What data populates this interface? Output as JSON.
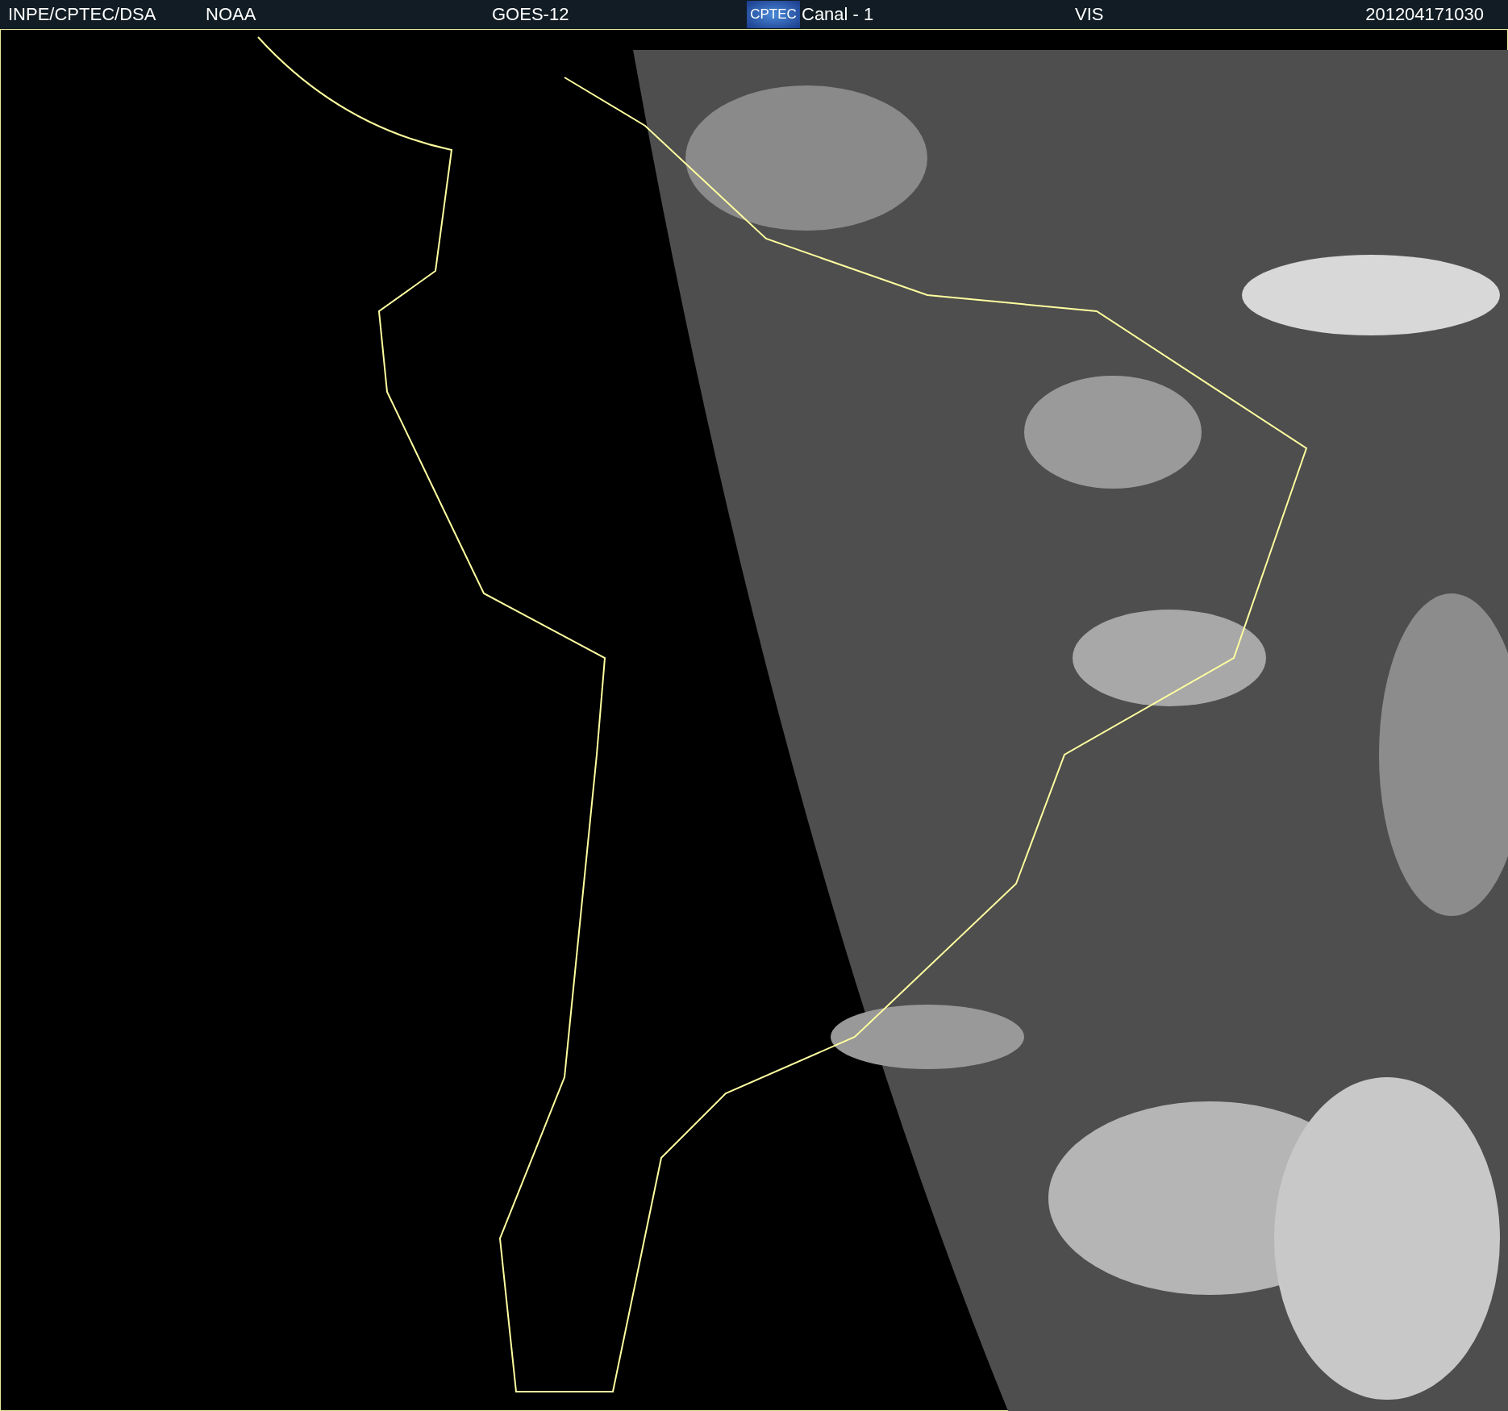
{
  "header": {
    "source": "INPE/CPTEC/DSA",
    "agency": "NOAA",
    "satellite": "GOES-12",
    "logo": "CPTEC",
    "channel": "Canal - 1",
    "band": "VIS",
    "timestamp": "201204171030"
  }
}
